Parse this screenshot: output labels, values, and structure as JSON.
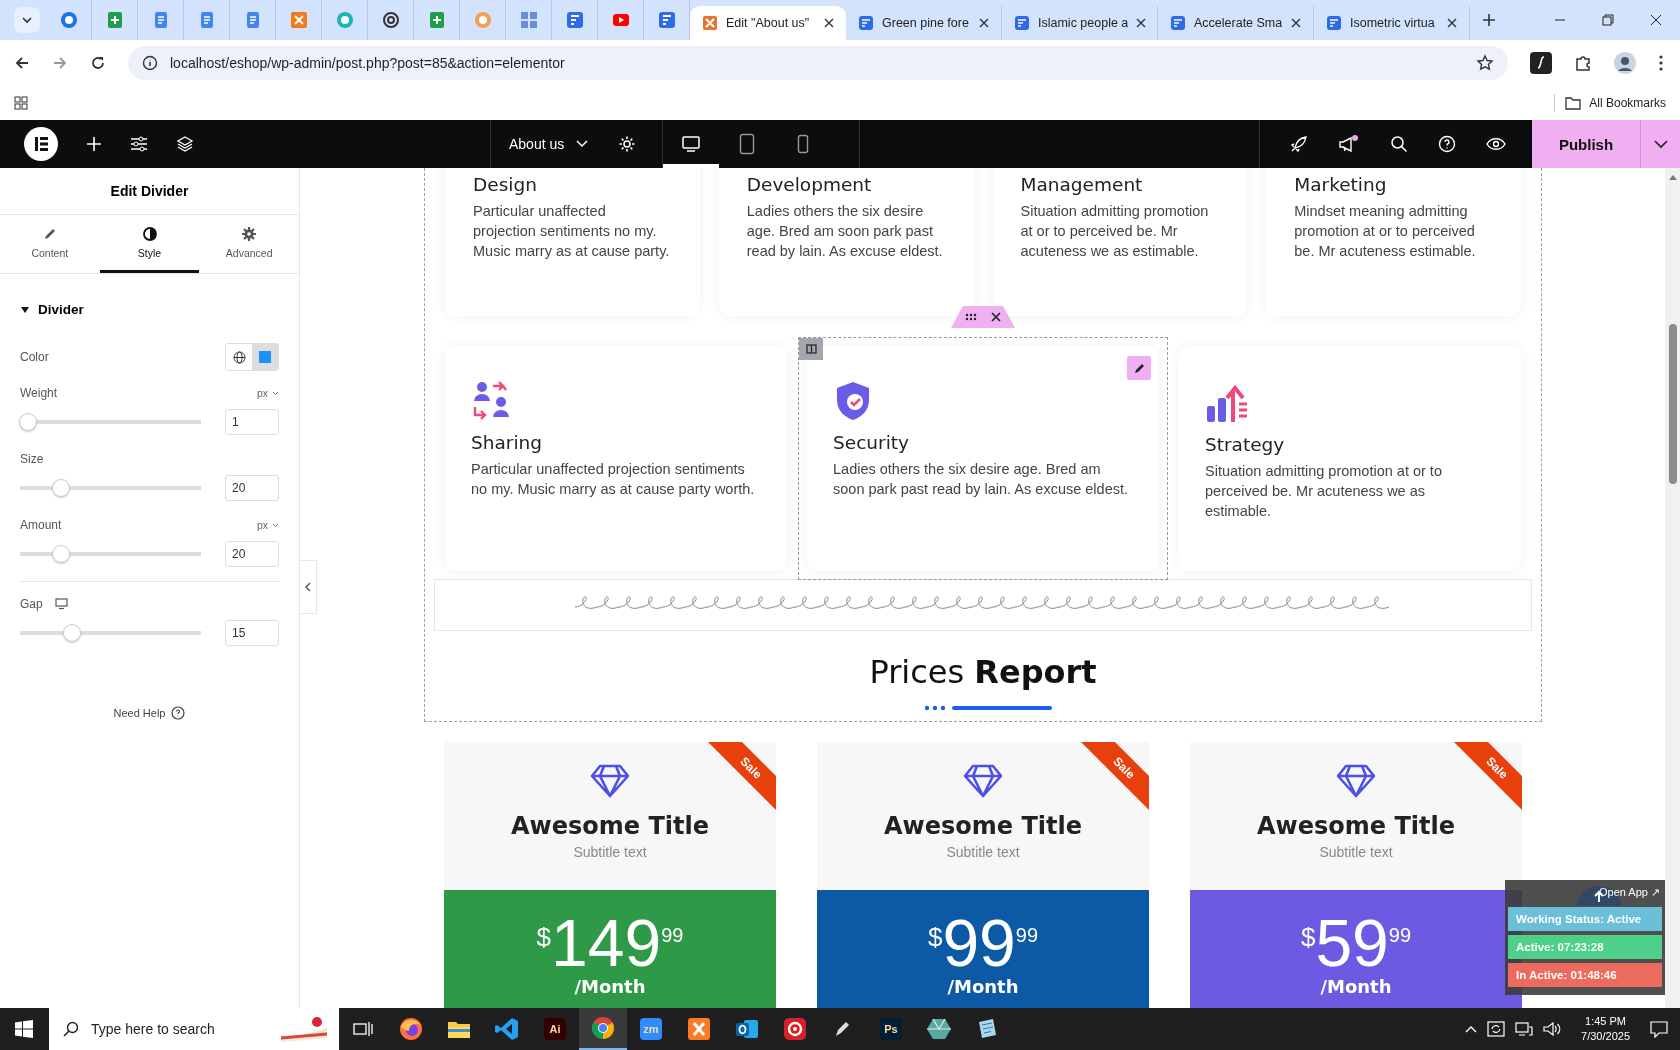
{
  "browser": {
    "tabs": [
      {
        "title": "Edit \"About us\"",
        "selected": true
      },
      {
        "title": "Green pine fore",
        "selected": false
      },
      {
        "title": "Islamic people a",
        "selected": false
      },
      {
        "title": "Accelerate Sma",
        "selected": false
      },
      {
        "title": "Isometric virtua",
        "selected": false
      }
    ],
    "address": "localhost/eshop/wp-admin/post.php?post=85&action=elementor",
    "bookmarks_label": "All Bookmarks"
  },
  "editor": {
    "page_title": "About us",
    "devices": [
      {
        "kind": "desktop",
        "selected": true
      },
      {
        "kind": "tablet",
        "selected": false
      },
      {
        "kind": "mobile",
        "selected": false
      }
    ],
    "publish": "Publish",
    "notification_unread": true
  },
  "panel": {
    "title": "Edit Divider",
    "tabs": [
      {
        "label": "Content",
        "kind": "pencil",
        "selected": false
      },
      {
        "label": "Style",
        "kind": "contrast",
        "selected": true
      },
      {
        "label": "Advanced",
        "kind": "gear",
        "selected": false
      }
    ],
    "section": {
      "label": "Divider",
      "expanded": true
    },
    "controls": [
      {
        "kind": "color",
        "label": "Color",
        "color": "#1e90ff"
      },
      {
        "kind": "slider",
        "label": "Weight",
        "unit": "px",
        "level": 0,
        "value": "1"
      },
      {
        "kind": "slider",
        "label": "Size",
        "level": 0.2,
        "value": "20"
      },
      {
        "kind": "slider",
        "label": "Amount",
        "unit": "px",
        "level": 0.2,
        "value": "20"
      },
      {
        "kind": "slider",
        "label": "Gap",
        "responsive": true,
        "level": 0.27,
        "value": "15",
        "separator": true
      }
    ],
    "help": "Need Help"
  },
  "canvas": {
    "features_top": [
      {
        "title": "Design",
        "text": "Particular unaffected projection sentiments no my. Music marry as at cause party."
      },
      {
        "title": "Development",
        "text": "Ladies others the six desire age. Bred am soon park past read by lain. As excuse eldest."
      },
      {
        "title": "Management",
        "text": "Situation admitting promotion at or to perceived be. Mr acuteness we as estimable."
      },
      {
        "title": "Marketing",
        "text": "Mindset meaning admitting promotion at or to perceived be. Mr acuteness estimable."
      }
    ],
    "features": [
      {
        "kind": "people",
        "title": "Sharing",
        "text": "Particular unaffected projection sentiments no my. Music marry as at cause party worth.",
        "selected": false
      },
      {
        "kind": "shield",
        "title": "Security",
        "text": "Ladies others the six desire age. Bred am soon park past read by lain. As excuse eldest.",
        "selected": true
      },
      {
        "kind": "chart",
        "title": "Strategy",
        "text": "Situation admitting promotion at or to perceived be. Mr acuteness we as estimable.",
        "selected": false
      }
    ],
    "heading": "Prices **Report**",
    "pricing": [
      {
        "title": "Awesome Title",
        "subtitle": "Subtitle text",
        "ribbon": "Sale",
        "currency": "$",
        "amount": "149",
        "cents": "99",
        "period": "/Month",
        "color": "#2e9a47"
      },
      {
        "title": "Awesome Title",
        "subtitle": "Subtitle text",
        "ribbon": "Sale",
        "currency": "$",
        "amount": "99",
        "cents": "99",
        "period": "/Month",
        "color": "#0c5aa6"
      },
      {
        "title": "Awesome Title",
        "subtitle": "Subtitle text",
        "ribbon": "Sale",
        "currency": "$",
        "amount": "59",
        "cents": "99",
        "period": "/Month",
        "color": "#6a5be2"
      }
    ]
  },
  "tracker": {
    "open_app": "Open App ↗",
    "rows": [
      {
        "text": "Working Status: Active",
        "color": "#6bbfd8"
      },
      {
        "text": "Active: 07:23:28",
        "color": "#4fd08a"
      },
      {
        "text": "In Active: 01:48:46",
        "color": "#ec6b5c"
      }
    ]
  },
  "taskbar": {
    "search_placeholder": "Type here to search",
    "apps": [
      {
        "kind": "taskview",
        "selected": false
      },
      {
        "kind": "firefox",
        "selected": false
      },
      {
        "kind": "folder",
        "selected": false
      },
      {
        "kind": "vscode",
        "selected": false
      },
      {
        "kind": "badge",
        "label": "Ai",
        "color": "#330000",
        "selected": false
      },
      {
        "kind": "chrome",
        "selected": true
      },
      {
        "kind": "badge",
        "label": "zm",
        "color": "#2d8cff",
        "selected": false
      },
      {
        "kind": "xampp",
        "selected": false
      },
      {
        "kind": "outlook",
        "selected": false
      },
      {
        "kind": "cloud",
        "selected": false
      },
      {
        "kind": "pen",
        "selected": false
      },
      {
        "kind": "badge",
        "label": "Ps",
        "color": "#001e36",
        "selected": false
      },
      {
        "kind": "cube",
        "selected": false
      },
      {
        "kind": "tile",
        "selected": false
      }
    ],
    "time": "1:45 PM",
    "date": "7/30/2025"
  }
}
